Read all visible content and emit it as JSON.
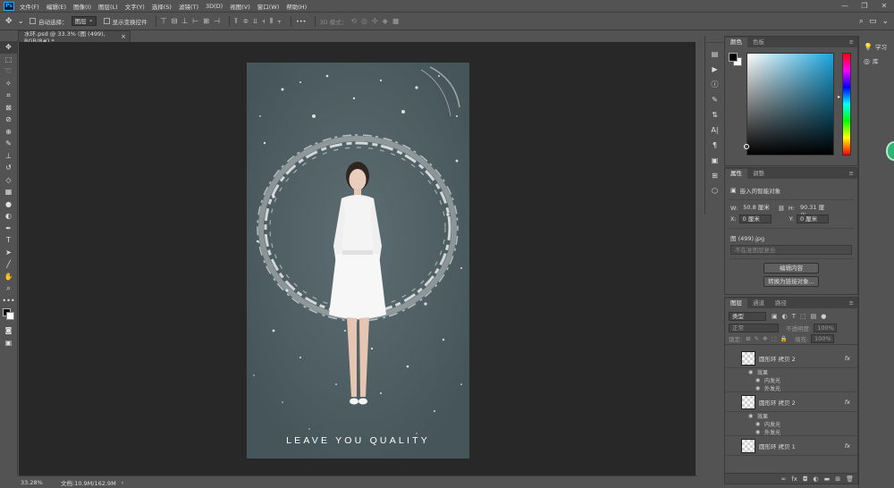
{
  "menubar": {
    "logo": "Ps",
    "items": [
      "文件(F)",
      "编辑(E)",
      "图像(I)",
      "图层(L)",
      "文字(Y)",
      "选择(S)",
      "滤镜(T)",
      "3D(D)",
      "视图(V)",
      "窗口(W)",
      "帮助(H)"
    ],
    "win_controls": [
      "—",
      "❐",
      "✕"
    ]
  },
  "options": {
    "auto_select_label": "自动选择：",
    "auto_select_value": "图层",
    "show_transform_label": "显示变换控件",
    "mode_3d_label": "3D 模式：",
    "more": "•••"
  },
  "document": {
    "tab_title": "水环.psd @ 33.3% (图 (499), RGB/8#) *",
    "tab_close": "×",
    "caption": "LEAVE YOU QUALITY"
  },
  "status": {
    "zoom": "33.28%",
    "doc_info": "文档:10.9M/162.9M",
    "arrow": "›"
  },
  "color_panel": {
    "tabs": [
      "颜色",
      "色板"
    ],
    "menu": "≡",
    "fg_color": "#000000",
    "bg_color": "#ffffff"
  },
  "properties_panel": {
    "tabs": [
      "属性",
      "调整"
    ],
    "menu": "≡",
    "type_label": "嵌入的智能对象",
    "w_label": "W:",
    "w_value": "50.8 厘米",
    "h_label": "H:",
    "h_value": "90.31 厘米",
    "x_label": "X:",
    "x_value": "0 厘米",
    "y_label": "Y:",
    "y_value": "0 厘米",
    "file_name": "图 (499).jpg",
    "comp_placeholder": "不在准图层复合",
    "edit_button": "编辑内容",
    "convert_button": "转换为链接对象..."
  },
  "layers_panel": {
    "tabs": [
      "图层",
      "通道",
      "路径"
    ],
    "menu": "≡",
    "filter_kind": "类型",
    "blend_mode": "正常",
    "opacity_label": "不透明度:",
    "opacity_value": "100%",
    "lock_label": "锁定:",
    "fill_label": "填充:",
    "fill_value": "100%",
    "layers": [
      {
        "name": "圆形环 拷贝 2",
        "fx": "fx",
        "effects_label": "效果",
        "effects": [
          "内发光",
          "外发光"
        ]
      },
      {
        "name": "圆形环 拷贝 2",
        "fx": "fx",
        "effects_label": "效果",
        "effects": [
          "内发光",
          "外发光"
        ]
      },
      {
        "name": "圆形环 拷贝 1",
        "fx": "fx"
      }
    ]
  },
  "far_right": {
    "learn_label": "学习",
    "library_label": "库"
  }
}
